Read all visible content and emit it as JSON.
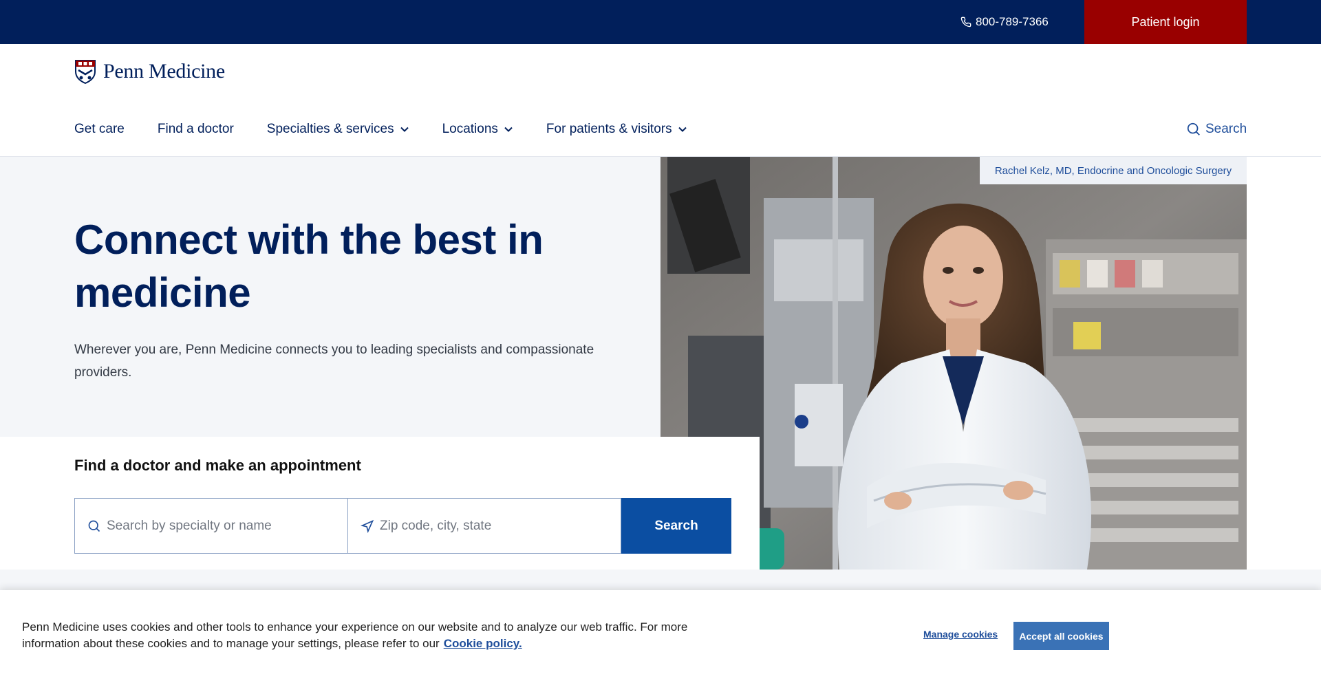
{
  "utility": {
    "phone": "800-789-7366",
    "patient_login": "Patient login"
  },
  "brand": {
    "name": "Penn Medicine"
  },
  "nav": {
    "items": [
      {
        "label": "Get care"
      },
      {
        "label": "Find a doctor"
      },
      {
        "label": "Specialties & services"
      },
      {
        "label": "Locations"
      },
      {
        "label": "For patients & visitors"
      }
    ],
    "search_label": "Search"
  },
  "hero": {
    "title": "Connect with the best in medicine",
    "subtitle": "Wherever you are, Penn Medicine connects you to leading specialists and compassionate providers.",
    "photo_caption": "Rachel Kelz, MD, Endocrine and Oncologic Surgery"
  },
  "find": {
    "title": "Find a doctor and make an appointment",
    "specialty_placeholder": "Search by specialty or name",
    "location_placeholder": "Zip code, city, state",
    "submit": "Search"
  },
  "cookie": {
    "text": "Penn Medicine uses cookies and other tools to enhance your experience on our website and to analyze our web traffic. For more information about these cookies and to manage your settings, please refer to our",
    "link": "Cookie policy.",
    "manage": "Manage cookies",
    "accept": "Accept all cookies"
  },
  "icons": {
    "phone": "phone-icon",
    "caret": "chevron-down-icon",
    "search": "search-icon",
    "location": "navigation-arrow-icon"
  },
  "colors": {
    "navy": "#011f5b",
    "red": "#990000",
    "blue": "#0b4ea2",
    "light_bg": "#f4f6f9"
  }
}
